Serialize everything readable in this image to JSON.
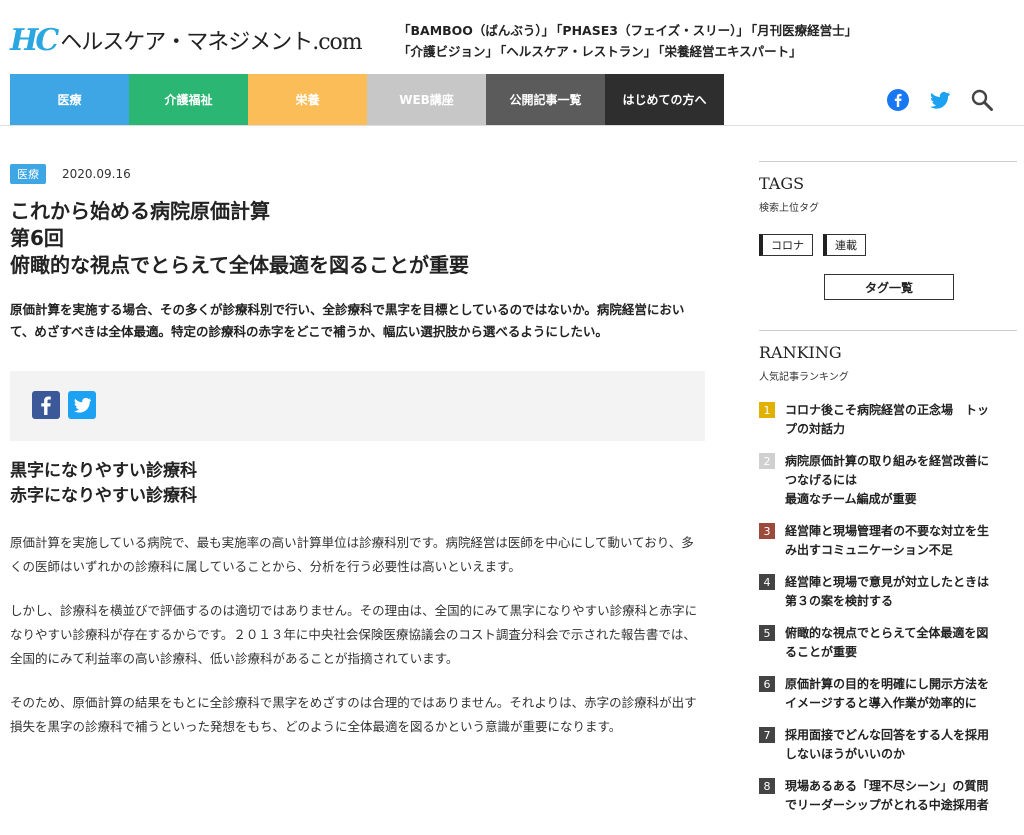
{
  "header": {
    "logo_mark": "HC",
    "logo_text": "ヘルスケア・マネジメント.com",
    "publications": [
      [
        "「BAMBOO（ばんぶう）」",
        "「PHASE3（フェイズ・スリー）」",
        "「月刊医療経営士」"
      ],
      [
        "「介護ビジョン」",
        "「ヘルスケア・レストラン」",
        "「栄養経営エキスパート」"
      ]
    ]
  },
  "nav": {
    "items": [
      {
        "label": "医療",
        "color": "#3fa6e6"
      },
      {
        "label": "介護福祉",
        "color": "#2bb673"
      },
      {
        "label": "栄養",
        "color": "#fbbd58"
      },
      {
        "label": "WEB講座",
        "color": "#c7c7c7"
      },
      {
        "label": "公開記事一覧",
        "color": "#5b5b5b"
      },
      {
        "label": "はじめての方へ",
        "color": "#2e2e2e"
      }
    ],
    "icons": [
      "facebook-icon",
      "twitter-icon",
      "search-icon"
    ]
  },
  "article": {
    "category": "医療",
    "date": "2020.09.16",
    "title_lines": [
      "これから始める病院原価計算",
      "第6回",
      "俯瞰的な視点でとらえて全体最適を図ることが重要"
    ],
    "lead": "原価計算を実施する場合、その多くが診療科別で行い、全診療科で黒字を目標としているのではないか。病院経営において、めざすべきは全体最適。特定の診療科の赤字をどこで補うか、幅広い選択肢から選べるようにしたい。",
    "heading_lines": [
      "黒字になりやすい診療科",
      "赤字になりやすい診療科"
    ],
    "paragraphs": [
      "原価計算を実施している病院で、最も実施率の高い計算単位は診療科別です。病院経営は医師を中心にして動いており、多くの医師はいずれかの診療科に属していることから、分析を行う必要性は高いといえます。",
      "しかし、診療科を横並びで評価するのは適切ではありません。その理由は、全国的にみて黒字になりやすい診療科と赤字になりやすい診療科が存在するからです。２０１３年に中央社会保険医療協議会のコスト調査分科会で示された報告書では、全国的にみて利益率の高い診療科、低い診療科があることが指摘されています。",
      "そのため、原価計算の結果をもとに全診療科で黒字をめざすのは合理的ではありません。それよりは、赤字の診療科が出す損失を黒字の診療科で補うといった発想をもち、どのように全体最適を図るかという意識が重要になります。"
    ]
  },
  "sidebar": {
    "tags_heading": "TAGS",
    "tags_sub": "検索上位タグ",
    "tags": [
      "コロナ",
      "連載"
    ],
    "tag_list_button": "タグ一覧",
    "ranking_heading": "RANKING",
    "ranking_sub": "人気記事ランキング",
    "ranking": [
      {
        "num": "1",
        "color": "#e0b100",
        "lines": [
          "コロナ後こそ病院経営の正念場　トッ",
          "プの対話力"
        ]
      },
      {
        "num": "2",
        "color": "#d0d0d0",
        "lines": [
          "病院原価計算の取り組みを経営改善に",
          "つなげるには",
          "最適なチーム編成が重要"
        ]
      },
      {
        "num": "3",
        "color": "#9c4a3c",
        "lines": [
          "経営陣と現場管理者の不要な対立を生",
          "み出すコミュニケーション不足"
        ]
      },
      {
        "num": "4",
        "color": "#444444",
        "lines": [
          "経営陣と現場で意見が対立したときは",
          "第３の案を検討する"
        ]
      },
      {
        "num": "5",
        "color": "#444444",
        "lines": [
          "俯瞰的な視点でとらえて全体最適を図",
          "ることが重要"
        ]
      },
      {
        "num": "6",
        "color": "#444444",
        "lines": [
          "原価計算の目的を明確にし開示方法を",
          "イメージすると導入作業が効率的に"
        ]
      },
      {
        "num": "7",
        "color": "#444444",
        "lines": [
          "採用面接でどんな回答をする人を採用",
          "しないほうがいいのか"
        ]
      },
      {
        "num": "8",
        "color": "#444444",
        "lines": [
          "現場あるある「理不尽シーン」の質問",
          "でリーダーシップがとれる中途採用者"
        ]
      }
    ]
  }
}
